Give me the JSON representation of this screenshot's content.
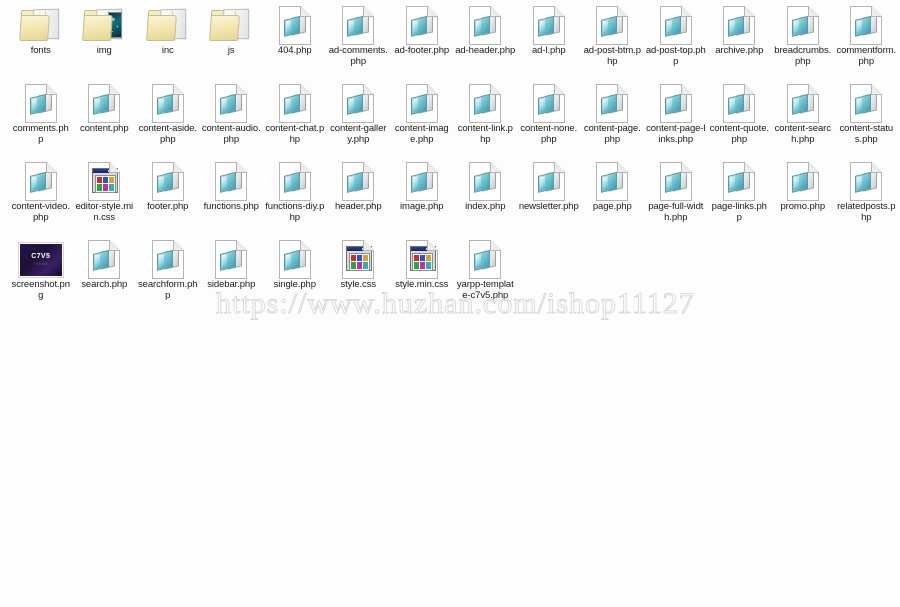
{
  "view": {
    "background_color": "#fdfdfd",
    "label_color": "#1c1c1c",
    "columns": 14
  },
  "watermark": {
    "text": "https://www.huzhan.com/ishop11127",
    "color": "#d9d9d9"
  },
  "thumbnail": {
    "title": "C7V5",
    "subtitle": "THEME"
  },
  "files": [
    {
      "name": "fonts",
      "icon": "folder-icon",
      "type": "folder"
    },
    {
      "name": "img",
      "icon": "folder-image-icon",
      "type": "folder"
    },
    {
      "name": "inc",
      "icon": "folder-icon",
      "type": "folder"
    },
    {
      "name": "js",
      "icon": "folder-icon",
      "type": "folder"
    },
    {
      "name": "404.php",
      "icon": "php-file-icon",
      "type": "php"
    },
    {
      "name": "ad-comments.php",
      "icon": "php-file-icon",
      "type": "php"
    },
    {
      "name": "ad-footer.php",
      "icon": "php-file-icon",
      "type": "php"
    },
    {
      "name": "ad-header.php",
      "icon": "php-file-icon",
      "type": "php"
    },
    {
      "name": "ad-l.php",
      "icon": "php-file-icon",
      "type": "php"
    },
    {
      "name": "ad-post-btm.php",
      "icon": "php-file-icon",
      "type": "php"
    },
    {
      "name": "ad-post-top.php",
      "icon": "php-file-icon",
      "type": "php"
    },
    {
      "name": "archive.php",
      "icon": "php-file-icon",
      "type": "php"
    },
    {
      "name": "breadcrumbs.php",
      "icon": "php-file-icon",
      "type": "php"
    },
    {
      "name": "commentform.php",
      "icon": "php-file-icon",
      "type": "php"
    },
    {
      "name": "comments.php",
      "icon": "php-file-icon",
      "type": "php"
    },
    {
      "name": "content.php",
      "icon": "php-file-icon",
      "type": "php"
    },
    {
      "name": "content-aside.php",
      "icon": "php-file-icon",
      "type": "php"
    },
    {
      "name": "content-audio.php",
      "icon": "php-file-icon",
      "type": "php"
    },
    {
      "name": "content-chat.php",
      "icon": "php-file-icon",
      "type": "php"
    },
    {
      "name": "content-gallery.php",
      "icon": "php-file-icon",
      "type": "php"
    },
    {
      "name": "content-image.php",
      "icon": "php-file-icon",
      "type": "php"
    },
    {
      "name": "content-link.php",
      "icon": "php-file-icon",
      "type": "php"
    },
    {
      "name": "content-none.php",
      "icon": "php-file-icon",
      "type": "php"
    },
    {
      "name": "content-page.php",
      "icon": "php-file-icon",
      "type": "php"
    },
    {
      "name": "content-page-links.php",
      "icon": "php-file-icon",
      "type": "php"
    },
    {
      "name": "content-quote.php",
      "icon": "php-file-icon",
      "type": "php"
    },
    {
      "name": "content-search.php",
      "icon": "php-file-icon",
      "type": "php"
    },
    {
      "name": "content-status.php",
      "icon": "php-file-icon",
      "type": "php"
    },
    {
      "name": "content-video.php",
      "icon": "php-file-icon",
      "type": "php"
    },
    {
      "name": "editor-style.min.css",
      "icon": "css-file-icon",
      "type": "css"
    },
    {
      "name": "footer.php",
      "icon": "php-file-icon",
      "type": "php"
    },
    {
      "name": "functions.php",
      "icon": "php-file-icon",
      "type": "php"
    },
    {
      "name": "functions-diy.php",
      "icon": "php-file-icon",
      "type": "php"
    },
    {
      "name": "header.php",
      "icon": "php-file-icon",
      "type": "php"
    },
    {
      "name": "image.php",
      "icon": "php-file-icon",
      "type": "php"
    },
    {
      "name": "index.php",
      "icon": "php-file-icon",
      "type": "php"
    },
    {
      "name": "newsletter.php",
      "icon": "php-file-icon",
      "type": "php"
    },
    {
      "name": "page.php",
      "icon": "php-file-icon",
      "type": "php"
    },
    {
      "name": "page-full-width.php",
      "icon": "php-file-icon",
      "type": "php"
    },
    {
      "name": "page-links.php",
      "icon": "php-file-icon",
      "type": "php"
    },
    {
      "name": "promo.php",
      "icon": "php-file-icon",
      "type": "php"
    },
    {
      "name": "relatedposts.php",
      "icon": "php-file-icon",
      "type": "php"
    },
    {
      "name": "screenshot.png",
      "icon": "png-thumbnail-icon",
      "type": "png"
    },
    {
      "name": "search.php",
      "icon": "php-file-icon",
      "type": "php"
    },
    {
      "name": "searchform.php",
      "icon": "php-file-icon",
      "type": "php"
    },
    {
      "name": "sidebar.php",
      "icon": "php-file-icon",
      "type": "php"
    },
    {
      "name": "single.php",
      "icon": "php-file-icon",
      "type": "php"
    },
    {
      "name": "style.css",
      "icon": "css-file-icon",
      "type": "css"
    },
    {
      "name": "style.min.css",
      "icon": "css-file-icon",
      "type": "css"
    },
    {
      "name": "yarpp-template-c7v5.php",
      "icon": "php-file-icon",
      "type": "php"
    }
  ]
}
